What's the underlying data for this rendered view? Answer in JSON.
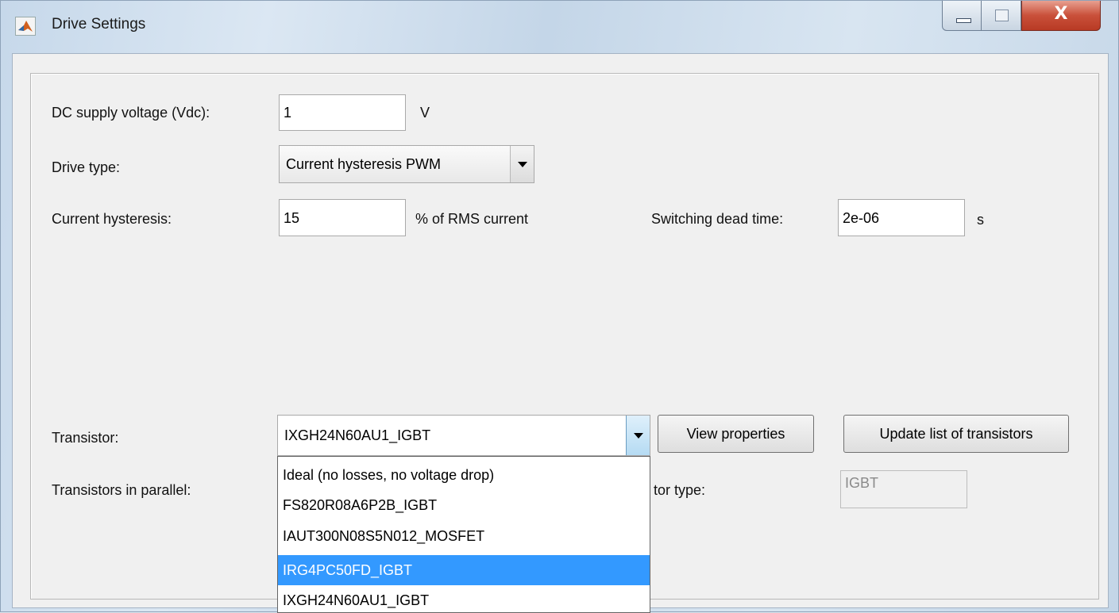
{
  "window": {
    "title": "Drive Settings",
    "close_glyph": "X"
  },
  "fields": {
    "dc_supply": {
      "label": "DC supply voltage (Vdc):",
      "value": "1",
      "unit": "V"
    },
    "drive_type": {
      "label": "Drive type:",
      "value": "Current hysteresis PWM"
    },
    "current_hysteresis": {
      "label": "Current hysteresis:",
      "value": "15",
      "unit": "% of RMS current"
    },
    "dead_time": {
      "label": "Switching dead time:",
      "value": "2e-06",
      "unit": "s"
    },
    "transistor": {
      "label": "Transistor:",
      "value": "IXGH24N60AU1_IGBT"
    },
    "parallel": {
      "label": "Transistors in parallel:"
    },
    "transistor_type": {
      "label": "tor type:",
      "value": "IGBT"
    }
  },
  "buttons": {
    "view_properties": "View properties",
    "update_list": "Update list of transistors"
  },
  "dropdown": {
    "options": [
      "Ideal (no losses, no voltage drop)",
      "FS820R08A6P2B_IGBT",
      "IAUT300N08S5N012_MOSFET",
      "IRG4PC50FD_IGBT",
      "IXGH24N60AU1_IGBT"
    ],
    "selected_index": 3
  },
  "icons": [
    "matlab-app-icon",
    "minimize-icon",
    "maximize-icon",
    "close-icon",
    "dropdown-arrow-icon"
  ]
}
